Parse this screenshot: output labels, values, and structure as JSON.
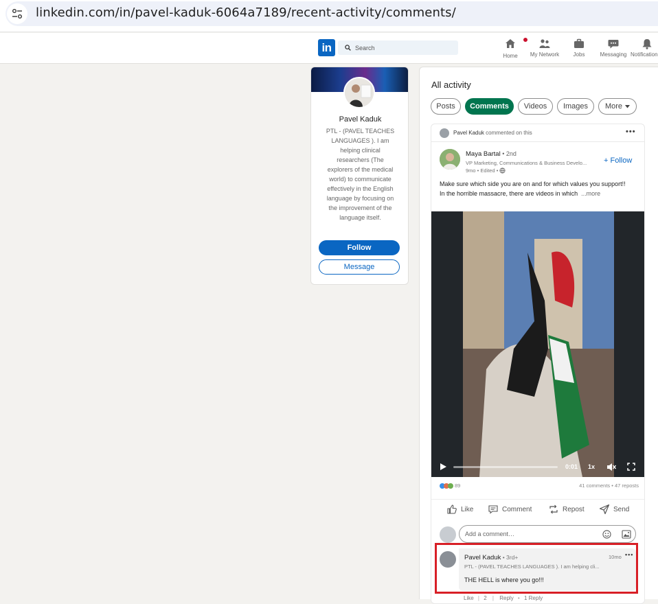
{
  "browser": {
    "url": "linkedin.com/in/pavel-kaduk-6064a7189/recent-activity/comments/"
  },
  "nav": {
    "logo": "in",
    "search_placeholder": "Search",
    "items": [
      {
        "label": "Home"
      },
      {
        "label": "My Network"
      },
      {
        "label": "Jobs"
      },
      {
        "label": "Messaging"
      },
      {
        "label": "Notifications"
      }
    ]
  },
  "profile": {
    "name": "Pavel Kaduk",
    "bio": "PTL - (PAVEL TEACHES LANGUAGES ). I am helping clinical researchers (The explorers of the medical world) to communicate effectively in the English language by focusing on the improvement of the language itself.",
    "follow_label": "Follow",
    "message_label": "Message"
  },
  "activity": {
    "title": "All activity",
    "filters": [
      "Posts",
      "Comments",
      "Videos",
      "Images",
      "More"
    ],
    "active_filter": "Comments"
  },
  "post": {
    "context_name": "Pavel Kaduk",
    "context_action": " commented on this",
    "author_name": "Maya Bartal",
    "author_degree": " • 2nd",
    "author_headline": "VP Marketing, Communications & Business Develo...",
    "author_meta": "9mo • Edited •",
    "follow_label": "+ Follow",
    "text_line1": "Make sure which side you are on and for which values you support!!",
    "text_line2": "In the horrible massacre, there are videos in which",
    "more_label": "...more",
    "video_time": "0:01",
    "video_speed": "1x",
    "reaction_count": "89",
    "comments_reposts": "41 comments • 47 reposts",
    "actions": [
      "Like",
      "Comment",
      "Repost",
      "Send"
    ],
    "comment_placeholder": "Add a comment…"
  },
  "comment": {
    "name": "Pavel Kaduk",
    "degree": " • 3rd+",
    "headline": "PTL - (PAVEL TEACHES LANGUAGES ). I am helping cli...",
    "time": "10mo",
    "text": "THE HELL is where you go!!!",
    "footer_like": "Like",
    "footer_like_count": "2",
    "footer_reply": "Reply",
    "footer_replies": "1 Reply"
  },
  "colors": {
    "linkedin_blue": "#0a66c2",
    "active_green": "#01754f",
    "highlight_red": "#d81f26"
  }
}
